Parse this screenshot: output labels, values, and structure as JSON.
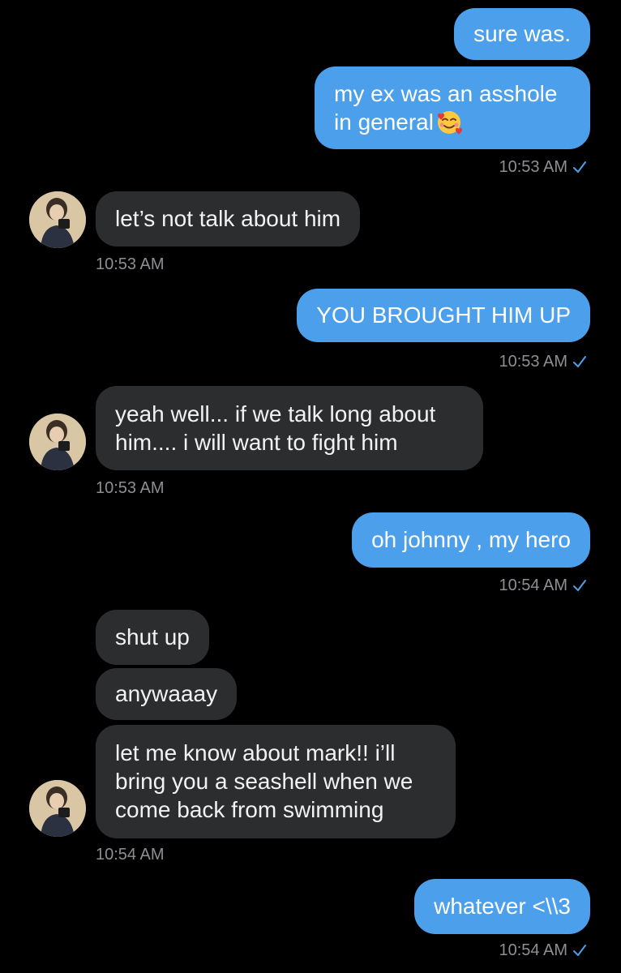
{
  "messages": [
    {
      "from": "me",
      "text": "sure was."
    },
    {
      "from": "me",
      "text_line1": "my ex was an asshole",
      "text_line2": "in general",
      "emoji": "smiling-face-with-hearts-emoji"
    },
    {
      "from": "me",
      "time": "10:53 AM"
    },
    {
      "from": "them",
      "text": "let’s not talk about him",
      "time": "10:53 AM"
    },
    {
      "from": "me",
      "text": "YOU BROUGHT HIM UP",
      "time": "10:53 AM"
    },
    {
      "from": "them",
      "text_line1": "yeah well... if we talk long about",
      "text_line2": "him.... i will want to fight him",
      "time": "10:53 AM"
    },
    {
      "from": "me",
      "text": "oh johnny , my hero",
      "time": "10:54 AM"
    },
    {
      "from": "them",
      "text": "shut up"
    },
    {
      "from": "them",
      "text": "anywaaay"
    },
    {
      "from": "them",
      "text_line1": "let me know about mark!! i’ll",
      "text_line2": "bring you a seashell when we",
      "text_line3": "come back from swimming",
      "time": "10:54 AM"
    },
    {
      "from": "me",
      "text": "whatever <\\\\3",
      "time": "10:54 AM"
    }
  ],
  "colors": {
    "background": "#000000",
    "outgoing_bubble": "#4c9fea",
    "incoming_bubble": "#2c2d2f",
    "timestamp": "#8e8e93",
    "read_check": "#4c9fea"
  },
  "icons": {
    "read_receipt": "check-icon",
    "contact_avatar": "avatar"
  }
}
